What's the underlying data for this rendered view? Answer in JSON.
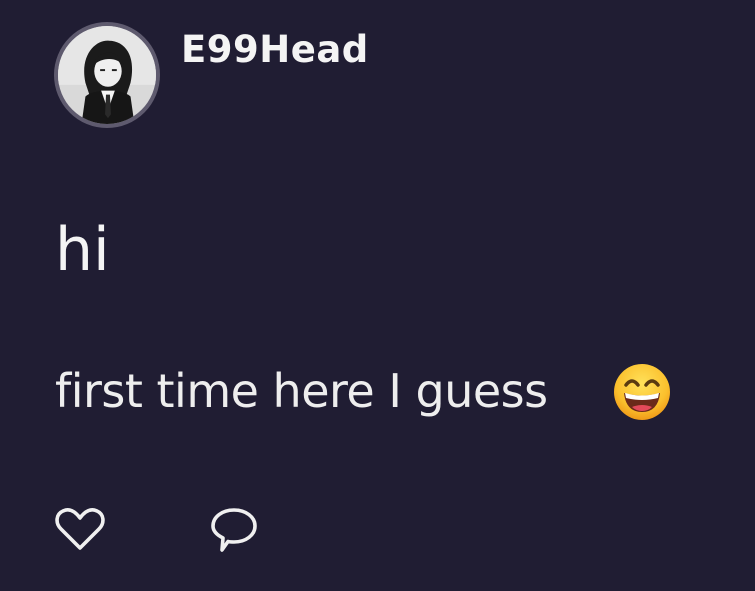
{
  "post": {
    "author": {
      "username": "E99Head",
      "avatar_icon": "avatar-image"
    },
    "title": "hi",
    "body": "first time here I guess",
    "body_emoji": "grinning-face-with-smiling-eyes",
    "actions": [
      {
        "name": "like",
        "icon": "heart-outline-icon"
      },
      {
        "name": "comment",
        "icon": "speech-bubble-outline-icon"
      }
    ]
  },
  "colors": {
    "background": "#201d33",
    "text": "#f4f4f4",
    "avatar_ring": "#5e5a6e"
  }
}
